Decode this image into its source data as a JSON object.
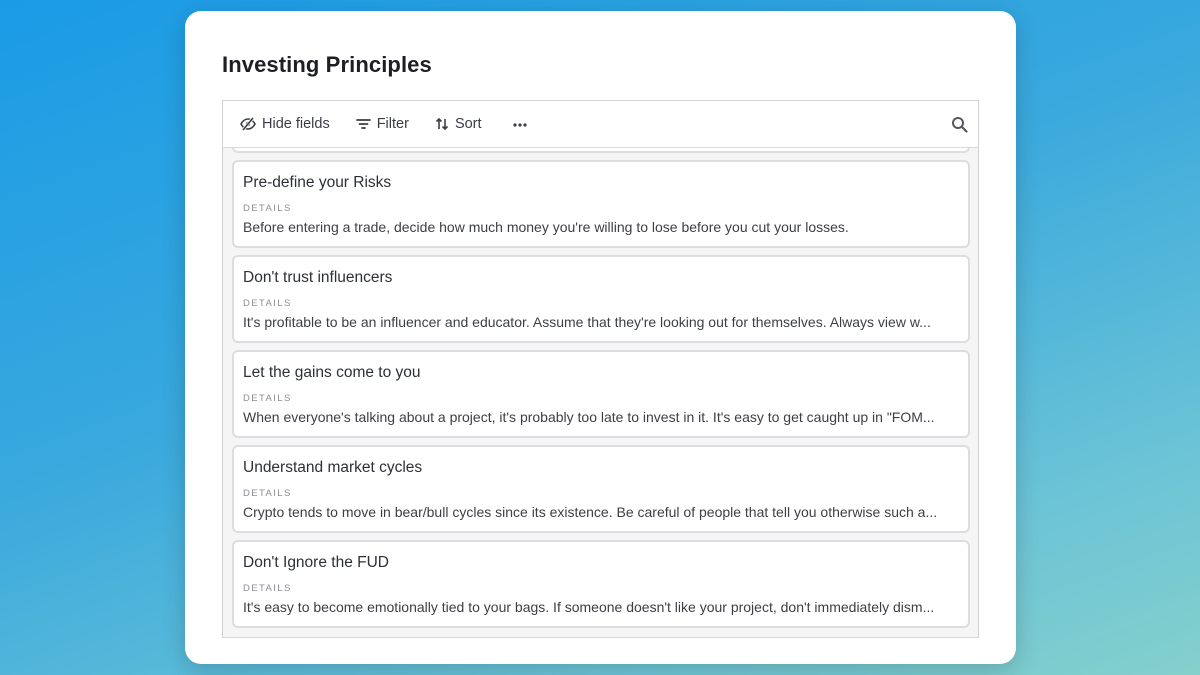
{
  "page": {
    "title": "Investing Principles"
  },
  "toolbar": {
    "hide_fields_label": "Hide fields",
    "filter_label": "Filter",
    "sort_label": "Sort",
    "more_icon": "more-horizontal-icon",
    "search_icon": "search-icon"
  },
  "records": [
    {
      "title": "Pre-define your Risks",
      "field_label": "DETAILS",
      "details": "Before entering a trade, decide how much money you're willing to lose before you cut your losses."
    },
    {
      "title": "Don't trust influencers",
      "field_label": "DETAILS",
      "details": "It's profitable to be an influencer and educator. Assume that they're looking out for themselves. Always view w..."
    },
    {
      "title": "Let the gains come to you",
      "field_label": "DETAILS",
      "details": "When everyone's talking about a project, it's probably too late to invest in it. It's easy to get caught up in \"FOM..."
    },
    {
      "title": "Understand market cycles",
      "field_label": "DETAILS",
      "details": "Crypto tends to move in bear/bull cycles since its existence. Be careful of people that tell you otherwise such a..."
    },
    {
      "title": "Don't Ignore the FUD",
      "field_label": "DETAILS",
      "details": "It's easy to become emotionally tied to your bags. If someone doesn't like your project, don't immediately dism..."
    }
  ]
}
